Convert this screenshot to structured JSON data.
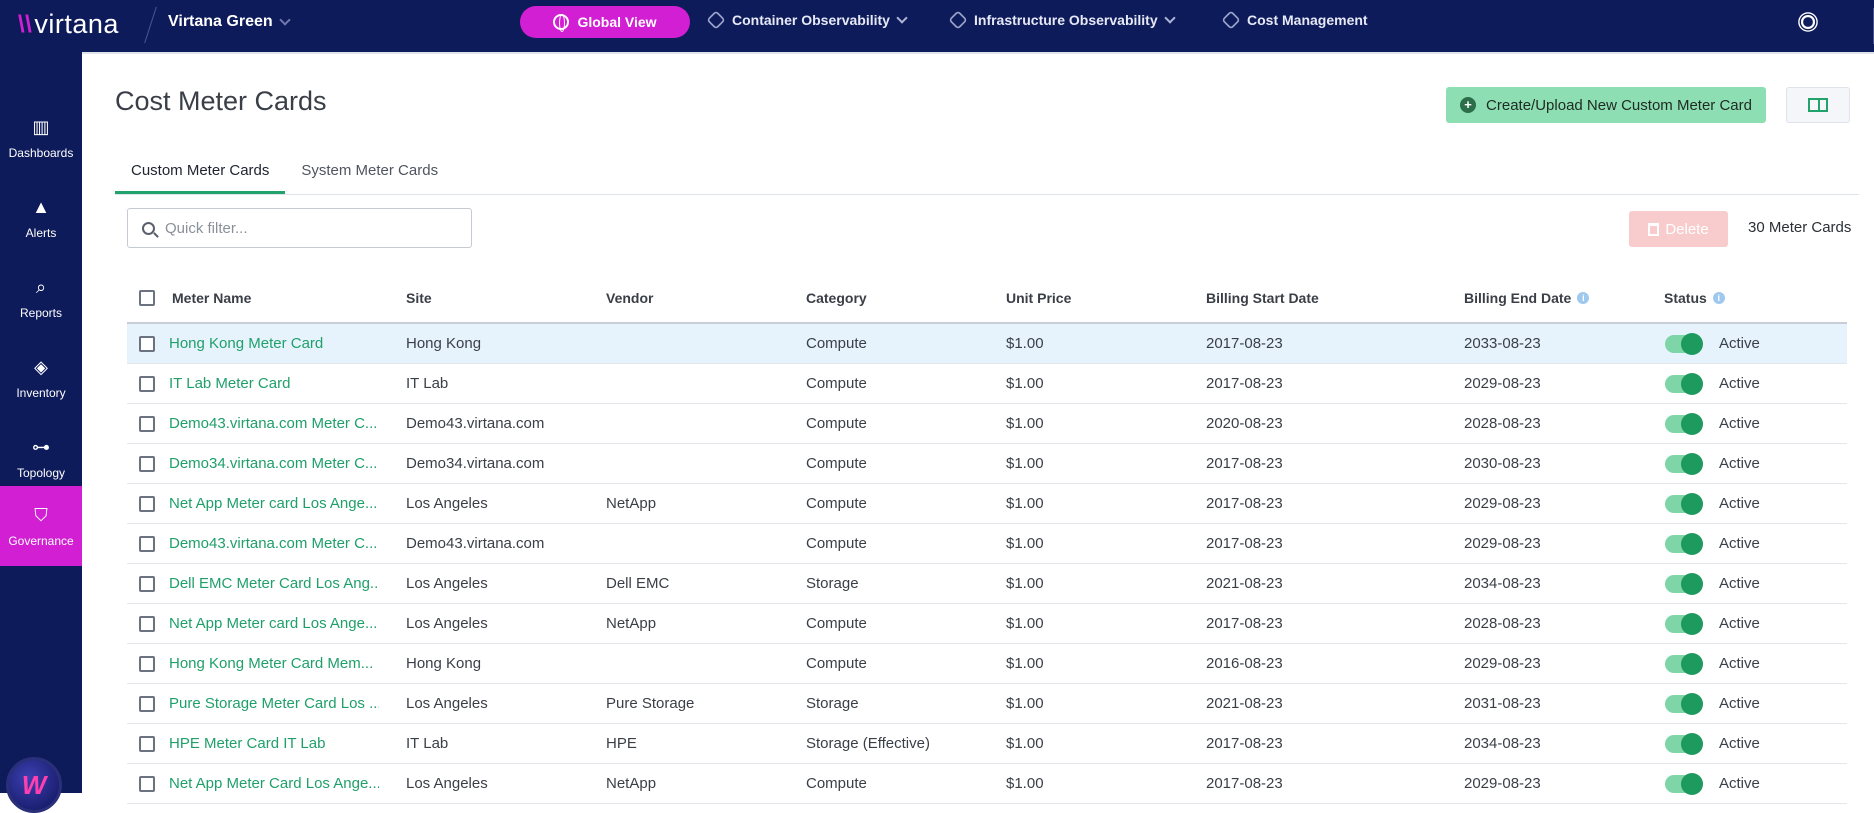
{
  "topbar": {
    "logo": "virtana",
    "tenant": "Virtana Green",
    "global_view": "Global View",
    "nav": [
      {
        "label": "Container Observability"
      },
      {
        "label": "Infrastructure Observability"
      },
      {
        "label": "Cost Management"
      }
    ]
  },
  "sidebar": {
    "items": [
      {
        "label": "Dashboards",
        "icon": "bar-chart-icon"
      },
      {
        "label": "Alerts",
        "icon": "warning-icon"
      },
      {
        "label": "Reports",
        "icon": "report-search-icon"
      },
      {
        "label": "Inventory",
        "icon": "layers-icon"
      },
      {
        "label": "Topology",
        "icon": "topology-icon"
      },
      {
        "label": "Governance",
        "icon": "shield-icon"
      }
    ]
  },
  "page": {
    "title": "Cost Meter Cards",
    "create_label": "Create/Upload New Custom Meter Card",
    "tabs": [
      "Custom Meter Cards",
      "System Meter Cards"
    ],
    "filter_placeholder": "Quick filter...",
    "delete_label": "Delete",
    "count": "30 Meter Cards"
  },
  "table": {
    "columns": [
      "Meter Name",
      "Site",
      "Vendor",
      "Category",
      "Unit Price",
      "Billing Start Date",
      "Billing End Date",
      "Status"
    ],
    "rows": [
      {
        "name": "Hong Kong Meter Card",
        "site": "Hong Kong",
        "vendor": "",
        "category": "Compute",
        "price": "$1.00",
        "start": "2017-08-23",
        "end": "2033-08-23",
        "status": "Active"
      },
      {
        "name": "IT Lab Meter Card",
        "site": "IT Lab",
        "vendor": "",
        "category": "Compute",
        "price": "$1.00",
        "start": "2017-08-23",
        "end": "2029-08-23",
        "status": "Active"
      },
      {
        "name": "Demo43.virtana.com Meter C...",
        "site": "Demo43.virtana.com",
        "vendor": "",
        "category": "Compute",
        "price": "$1.00",
        "start": "2020-08-23",
        "end": "2028-08-23",
        "status": "Active"
      },
      {
        "name": "Demo34.virtana.com Meter C...",
        "site": "Demo34.virtana.com",
        "vendor": "",
        "category": "Compute",
        "price": "$1.00",
        "start": "2017-08-23",
        "end": "2030-08-23",
        "status": "Active"
      },
      {
        "name": "Net App Meter card Los Ange...",
        "site": "Los Angeles",
        "vendor": "NetApp",
        "category": "Compute",
        "price": "$1.00",
        "start": "2017-08-23",
        "end": "2029-08-23",
        "status": "Active"
      },
      {
        "name": "Demo43.virtana.com Meter C...",
        "site": "Demo43.virtana.com",
        "vendor": "",
        "category": "Compute",
        "price": "$1.00",
        "start": "2017-08-23",
        "end": "2029-08-23",
        "status": "Active"
      },
      {
        "name": "Dell EMC Meter Card Los Ang...",
        "site": "Los Angeles",
        "vendor": "Dell EMC",
        "category": "Storage",
        "price": "$1.00",
        "start": "2021-08-23",
        "end": "2034-08-23",
        "status": "Active"
      },
      {
        "name": "Net App Meter card Los Ange...",
        "site": "Los Angeles",
        "vendor": "NetApp",
        "category": "Compute",
        "price": "$1.00",
        "start": "2017-08-23",
        "end": "2028-08-23",
        "status": "Active"
      },
      {
        "name": "Hong Kong Meter Card Mem...",
        "site": "Hong Kong",
        "vendor": "",
        "category": "Compute",
        "price": "$1.00",
        "start": "2016-08-23",
        "end": "2029-08-23",
        "status": "Active"
      },
      {
        "name": "Pure Storage Meter Card Los ...",
        "site": "Los Angeles",
        "vendor": "Pure Storage",
        "category": "Storage",
        "price": "$1.00",
        "start": "2021-08-23",
        "end": "2031-08-23",
        "status": "Active"
      },
      {
        "name": "HPE Meter Card IT Lab",
        "site": "IT Lab",
        "vendor": "HPE",
        "category": "Storage (Effective)",
        "price": "$1.00",
        "start": "2017-08-23",
        "end": "2034-08-23",
        "status": "Active"
      },
      {
        "name": "Net App Meter Card Los Ange...",
        "site": "Los Angeles",
        "vendor": "NetApp",
        "category": "Compute",
        "price": "$1.00",
        "start": "2017-08-23",
        "end": "2029-08-23",
        "status": "Active"
      }
    ]
  }
}
